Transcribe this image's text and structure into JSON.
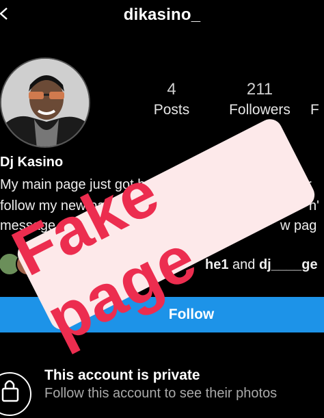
{
  "header": {
    "username": "dikasino_"
  },
  "stats": {
    "posts": {
      "count": "4",
      "label": "Posts"
    },
    "followers": {
      "count": "211",
      "label": "Followers"
    },
    "following": {
      "label_partial": "F"
    }
  },
  "profile": {
    "display_name": "Dj Kasino",
    "bio_lines": [
      "My main page just got h",
      "follow my new pag",
      "message my"
    ],
    "bio_right": [
      "ver",
      "n'",
      "w pag"
    ]
  },
  "mutuals": {
    "name1": "he1",
    "and": "and",
    "name2": "dj____ge"
  },
  "actions": {
    "follow_label": "Follow"
  },
  "private": {
    "title": "This account is private",
    "subtitle": "Follow this account to see their photos"
  },
  "overlay": {
    "stamp_text": "Fake page",
    "stamp_color": "#ec2d4f"
  },
  "colors": {
    "follow_button": "#1d93e8",
    "background": "#000000"
  }
}
